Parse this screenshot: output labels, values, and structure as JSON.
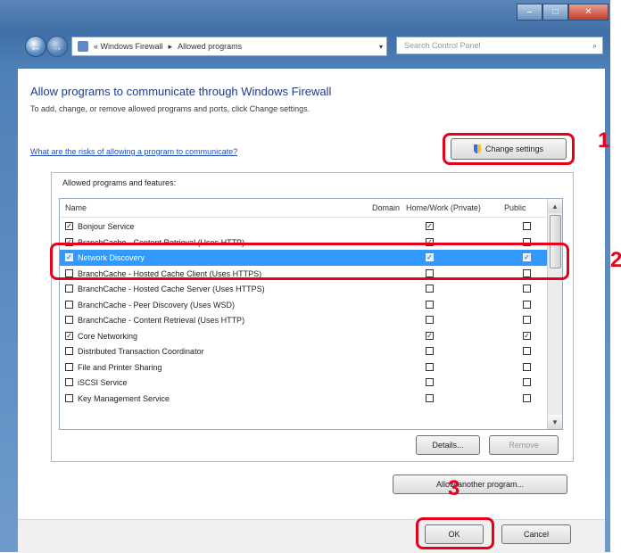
{
  "window": {
    "nav_back": "←",
    "nav_forward": "→",
    "breadcrumb": [
      "« Windows Firewall",
      "Allowed programs"
    ],
    "search_placeholder": "Search Control Panel",
    "controls": {
      "minimize": "–",
      "maximize": "□",
      "close": "✕"
    }
  },
  "page": {
    "heading": "Allow programs to communicate through Windows Firewall",
    "description": "To add, change, or remove allowed programs and ports, click Change settings.",
    "risk_link": "What are the risks of allowing a program to communicate?",
    "change_settings_button": "Change settings",
    "group_label": "Allowed programs and features:",
    "columns": {
      "name": "Name",
      "domain": "Domain",
      "home_work": "Home/Work (Private)",
      "public": "Public"
    },
    "programs": [
      {
        "name": "Bonjour Service",
        "enabled": true,
        "private": true,
        "public": false,
        "selected": false
      },
      {
        "name": "BranchCache - Content Retrieval (Uses HTTP)",
        "enabled": true,
        "private": true,
        "public": false,
        "selected": false
      },
      {
        "name": "Network Discovery",
        "enabled": true,
        "private": true,
        "public": true,
        "selected": true
      },
      {
        "name": "BranchCache - Hosted Cache Client (Uses HTTPS)",
        "enabled": false,
        "private": false,
        "public": false,
        "selected": false
      },
      {
        "name": "BranchCache - Hosted Cache Server (Uses HTTPS)",
        "enabled": false,
        "private": false,
        "public": false,
        "selected": false
      },
      {
        "name": "BranchCache - Peer Discovery (Uses WSD)",
        "enabled": false,
        "private": false,
        "public": false,
        "selected": false
      },
      {
        "name": "BranchCache - Content Retrieval (Uses HTTP)",
        "enabled": false,
        "private": false,
        "public": false,
        "selected": false
      },
      {
        "name": "Core Networking",
        "enabled": true,
        "private": true,
        "public": true,
        "selected": false
      },
      {
        "name": "Distributed Transaction Coordinator",
        "enabled": false,
        "private": false,
        "public": false,
        "selected": false
      },
      {
        "name": "File and Printer Sharing",
        "enabled": false,
        "private": false,
        "public": false,
        "selected": false
      },
      {
        "name": "iSCSI Service",
        "enabled": false,
        "private": false,
        "public": false,
        "selected": false
      },
      {
        "name": "Key Management Service",
        "enabled": false,
        "private": false,
        "public": false,
        "selected": false
      }
    ],
    "details_button": "Details...",
    "remove_button": "Remove",
    "allow_another_button": "Allow another program...",
    "ok_button": "OK",
    "cancel_button": "Cancel"
  },
  "annotations": {
    "marker1": "1",
    "marker2": "2",
    "marker3": "3",
    "color": "#e6001a"
  }
}
